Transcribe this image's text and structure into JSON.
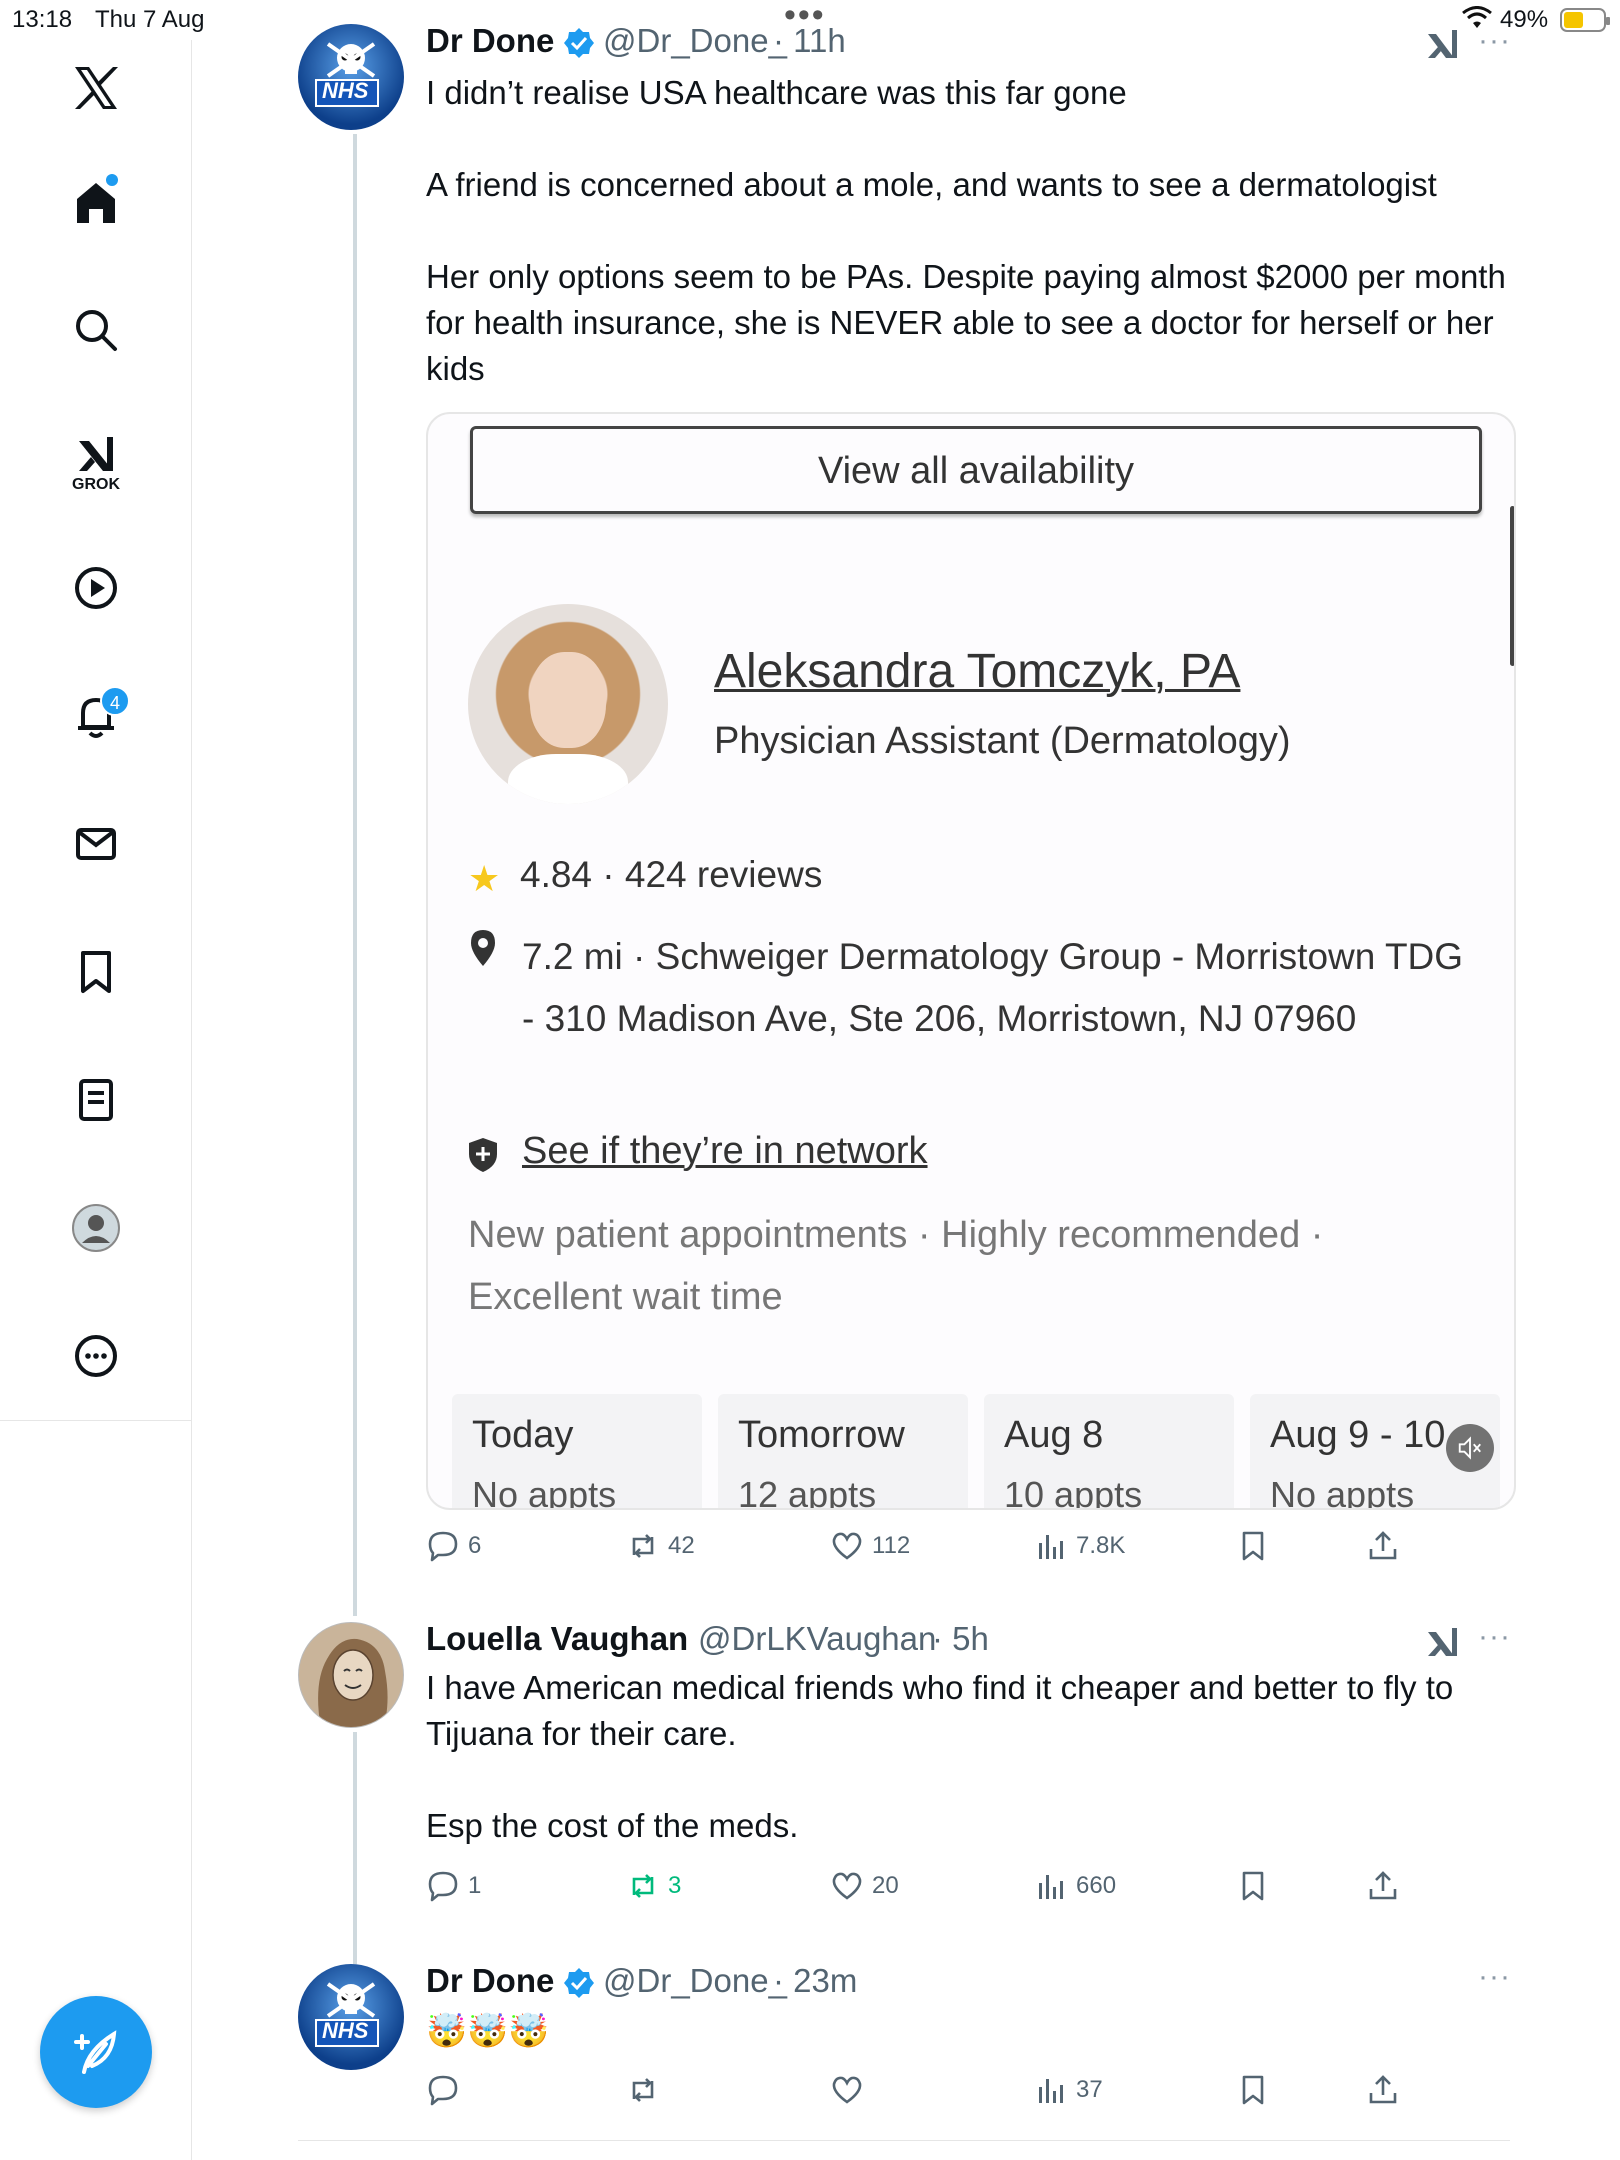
{
  "status_bar": {
    "time": "13:18",
    "date": "Thu 7 Aug",
    "battery": "49%",
    "battery_level": 0.49
  },
  "sidebar": {
    "notifications_count": "4",
    "grok_label": "GROK",
    "accent": "#1d9bf0"
  },
  "tweets": [
    {
      "name": "Dr Done",
      "handle": "@Dr_Done_",
      "time": "· 11h",
      "avatar_text": "NHS",
      "text": "I didn’t realise USA healthcare was this far gone\n\nA friend is concerned about a mole, and wants to see a dermatologist\n\nHer only options seem to be PAs. Despite paying almost $2000 per month for health insurance, she is NEVER able to see a doctor for herself or her kids",
      "replies": "6",
      "reposts": "42",
      "likes": "112",
      "views": "7.8K"
    },
    {
      "name": "Louella Vaughan",
      "handle": "@DrLKVaughan",
      "time": "· 5h",
      "text": "I have American medical friends who find it cheaper and better to fly to Tijuana for their care.\n\nEsp the cost of the meds.",
      "replies": "1",
      "reposts": "3",
      "likes": "20",
      "views": "660"
    },
    {
      "name": "Dr Done",
      "handle": "@Dr_Done_",
      "time": "· 23m",
      "avatar_text": "NHS",
      "text": "🤯🤯🤯",
      "replies": "",
      "reposts": "",
      "likes": "",
      "views": "37"
    }
  ],
  "media": {
    "view_all": "View all availability",
    "doctor_name": "Aleksandra Tomczyk, PA",
    "doctor_role": "Physician Assistant (Dermatology)",
    "rating": "4.84 · 424 reviews",
    "address": "7.2 mi · Schweiger Dermatology Group - Morristown TDG - 310 Madison Ave, Ste 206, Morristown, NJ 07960",
    "network": "See if they’re in network",
    "tags": "New patient appointments · Highly recommended · Excellent wait time",
    "days": [
      {
        "label": "Today",
        "sub": "No appts"
      },
      {
        "label": "Tomorrow",
        "sub": "12 appts"
      },
      {
        "label": "Aug 8",
        "sub": "10 appts"
      },
      {
        "label": "Aug 9 - 10",
        "sub": "No appts"
      }
    ]
  }
}
